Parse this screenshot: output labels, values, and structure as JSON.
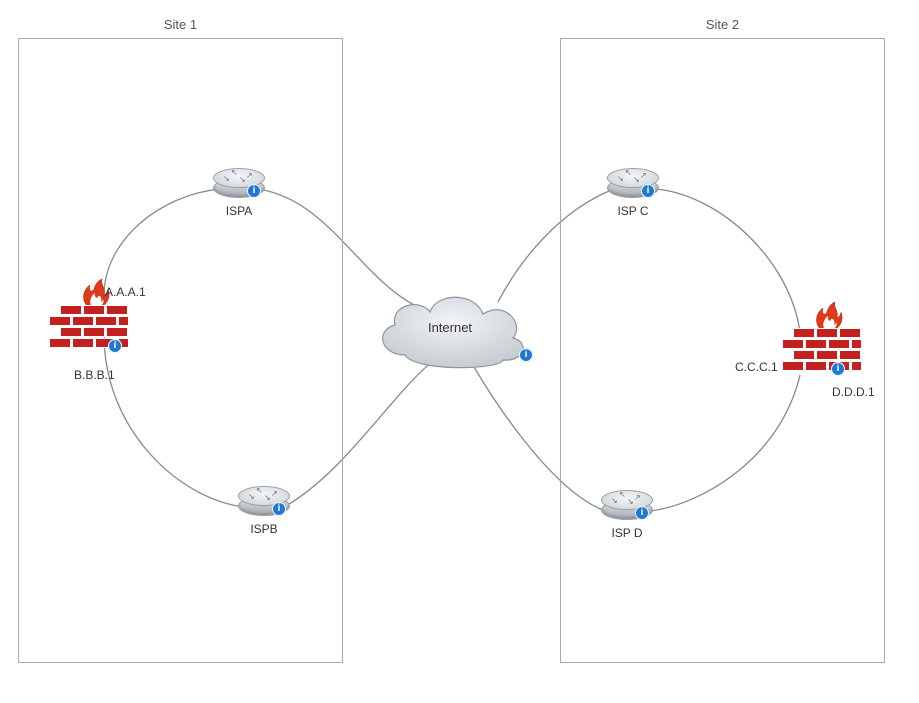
{
  "sites": {
    "site1": {
      "label": "Site 1"
    },
    "site2": {
      "label": "Site 2"
    }
  },
  "routers": {
    "ispa": {
      "label": "ISPA"
    },
    "ispb": {
      "label": "ISPB"
    },
    "ispc": {
      "label": "ISP C"
    },
    "ispd": {
      "label": "ISP D"
    }
  },
  "internet": {
    "label": "Internet"
  },
  "firewalls": {
    "fw1": {
      "iface_top": "A.A.A.1",
      "iface_bottom": "B.B.B.1"
    },
    "fw2": {
      "iface_left": "C.C.C.1",
      "iface_right": "D.D.D.1"
    }
  }
}
